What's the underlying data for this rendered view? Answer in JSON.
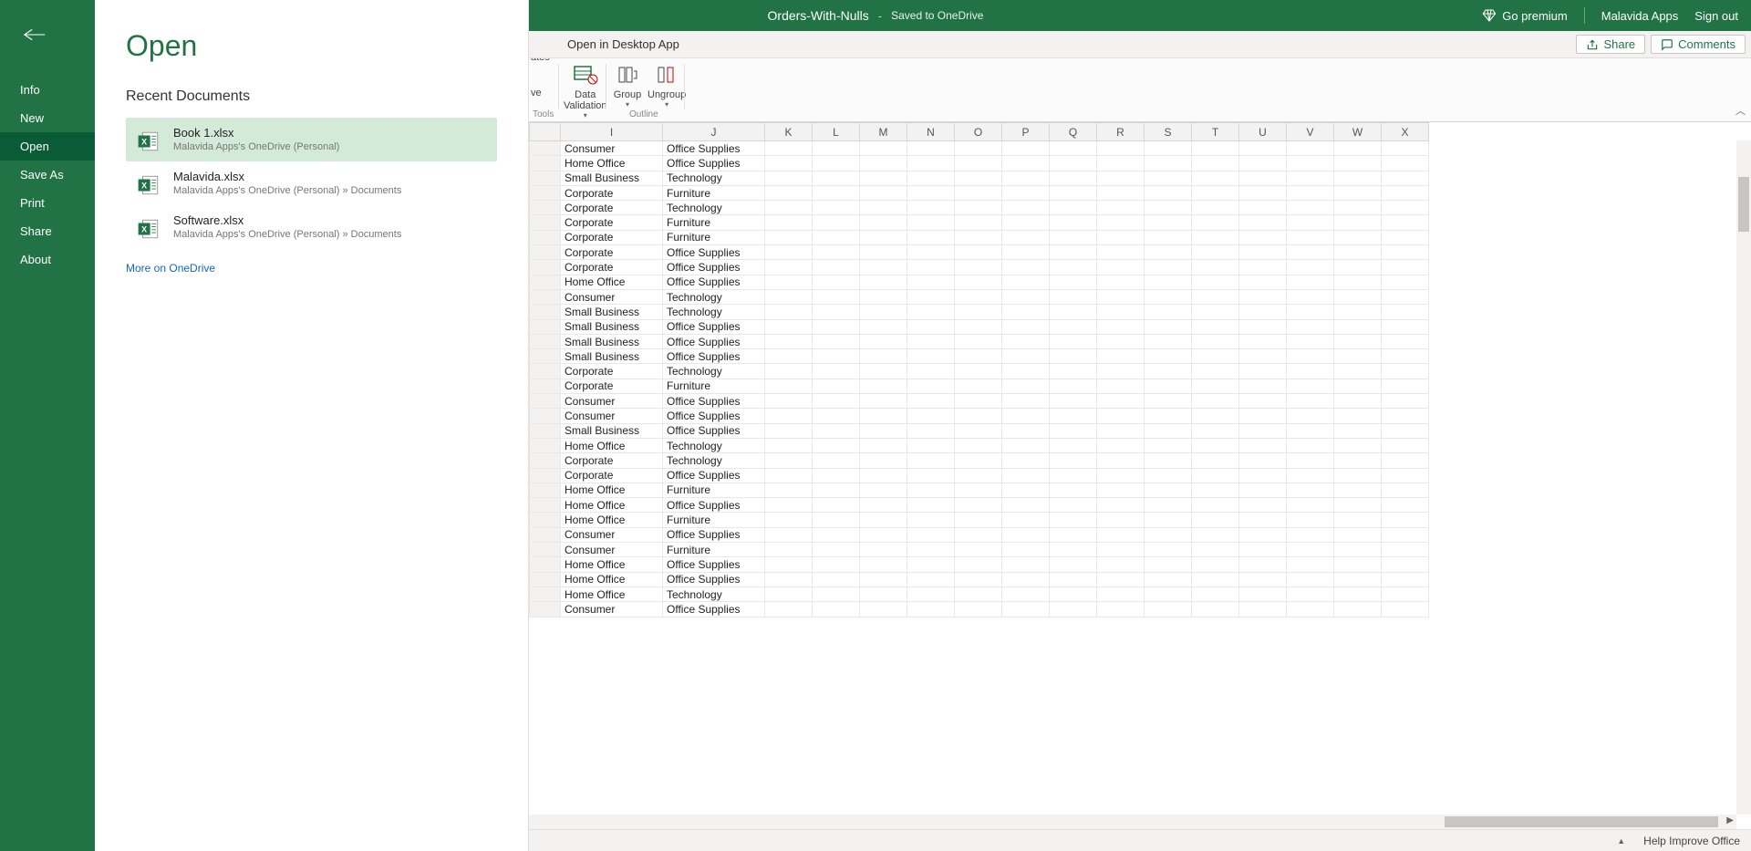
{
  "title": {
    "docname": "Orders-With-Nulls",
    "saved": "Saved to OneDrive",
    "premium": "Go premium",
    "account": "Malavida Apps",
    "signout": "Sign out"
  },
  "commandbar": {
    "open_desktop": "Open in Desktop App",
    "share": "Share",
    "comments": "Comments"
  },
  "ribbon": {
    "cut1": "ve",
    "cut2": "ates",
    "data_validation": "Data\nValidation",
    "group": "Group",
    "ungroup": "Ungroup",
    "tools": "Tools",
    "outline": "Outline"
  },
  "file": {
    "heading": "Open",
    "recent": "Recent Documents",
    "nav": {
      "info": "Info",
      "new": "New",
      "open": "Open",
      "saveas": "Save As",
      "print": "Print",
      "share": "Share",
      "about": "About"
    },
    "docs": [
      {
        "name": "Book 1.xlsx",
        "loc": "Malavida Apps's OneDrive (Personal)"
      },
      {
        "name": "Malavida.xlsx",
        "loc": "Malavida Apps's OneDrive (Personal) » Documents"
      },
      {
        "name": "Software.xlsx",
        "loc": "Malavida Apps's OneDrive (Personal) » Documents"
      }
    ],
    "more": "More on OneDrive"
  },
  "sheet": {
    "columns": [
      "I",
      "J",
      "K",
      "L",
      "M",
      "N",
      "O",
      "P",
      "Q",
      "R",
      "S",
      "T",
      "U",
      "V",
      "W",
      "X"
    ],
    "rows": [
      [
        "Consumer",
        "Office Supplies"
      ],
      [
        "Home Office",
        "Office Supplies"
      ],
      [
        "Small Business",
        "Technology"
      ],
      [
        "Corporate",
        "Furniture"
      ],
      [
        "Corporate",
        "Technology"
      ],
      [
        "Corporate",
        "Furniture"
      ],
      [
        "Corporate",
        "Furniture"
      ],
      [
        "Corporate",
        "Office Supplies"
      ],
      [
        "Corporate",
        "Office Supplies"
      ],
      [
        "Home Office",
        "Office Supplies"
      ],
      [
        "Consumer",
        "Technology"
      ],
      [
        "Small Business",
        "Technology"
      ],
      [
        "Small Business",
        "Office Supplies"
      ],
      [
        "Small Business",
        "Office Supplies"
      ],
      [
        "Small Business",
        "Office Supplies"
      ],
      [
        "Corporate",
        "Technology"
      ],
      [
        "Corporate",
        "Furniture"
      ],
      [
        "Consumer",
        "Office Supplies"
      ],
      [
        "Consumer",
        "Office Supplies"
      ],
      [
        "Small Business",
        "Office Supplies"
      ],
      [
        "Home Office",
        "Technology"
      ],
      [
        "Corporate",
        "Technology"
      ],
      [
        "Corporate",
        "Office Supplies"
      ],
      [
        "Home Office",
        "Furniture"
      ],
      [
        "Home Office",
        "Office Supplies"
      ],
      [
        "Home Office",
        "Furniture"
      ],
      [
        "Consumer",
        "Office Supplies"
      ],
      [
        "Consumer",
        "Furniture"
      ],
      [
        "Home Office",
        "Office Supplies"
      ],
      [
        "Home Office",
        "Office Supplies"
      ],
      [
        "Home Office",
        "Technology"
      ],
      [
        "Consumer",
        "Office Supplies"
      ]
    ]
  },
  "status": {
    "help": "Help Improve Office"
  }
}
